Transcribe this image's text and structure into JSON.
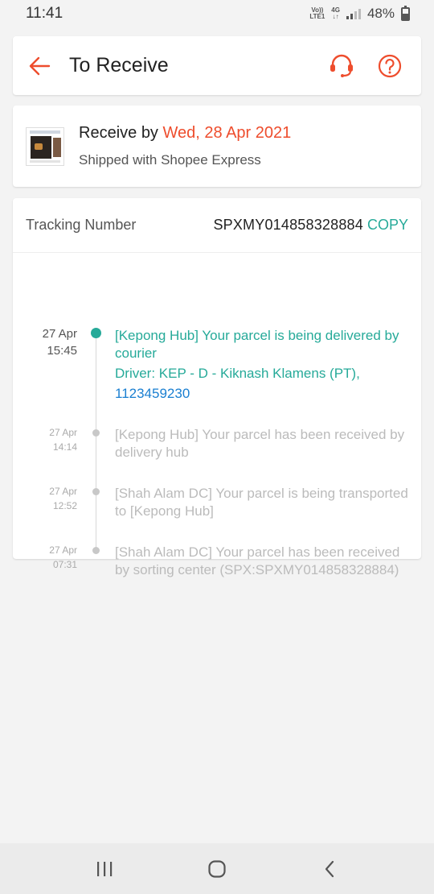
{
  "status_bar": {
    "time": "11:41",
    "volte": "Vo)) LTE1",
    "network": "4G",
    "battery": "48%",
    "battery_level": 0.48
  },
  "header": {
    "title": "To Receive",
    "icons": [
      "back-arrow-icon",
      "headset-support-icon",
      "help-question-icon"
    ],
    "accent_color": "#ee4d2d"
  },
  "receive": {
    "label": "Receive by ",
    "date": "Wed, 28 Apr 2021",
    "shipping": "Shipped with Shopee Express"
  },
  "tracking": {
    "label": "Tracking Number",
    "number": "SPXMY014858328884",
    "copy_label": "COPY",
    "accent_color": "#26aa99",
    "events": [
      {
        "date": "27 Apr",
        "time": "15:45",
        "text": "[Kepong Hub] Your parcel is being delivered by courier",
        "driver": "Driver: KEP - D - Kiknash Klamens (PT),",
        "phone": "1123459230",
        "active": true
      },
      {
        "date": "27 Apr",
        "time": "14:14",
        "text": "[Kepong Hub] Your parcel has been received by delivery hub",
        "active": false
      },
      {
        "date": "27 Apr",
        "time": "12:52",
        "text": "[Shah Alam DC] Your parcel is being transported to [Kepong Hub]",
        "active": false
      },
      {
        "date": "27 Apr",
        "time": "07:31",
        "text": "[Shah Alam DC] Your parcel has been received by sorting center (SPX:SPXMY014858328884)",
        "active": false
      }
    ]
  },
  "nav_bar": {
    "icons": [
      "recent-apps-icon",
      "home-icon",
      "back-icon"
    ]
  }
}
